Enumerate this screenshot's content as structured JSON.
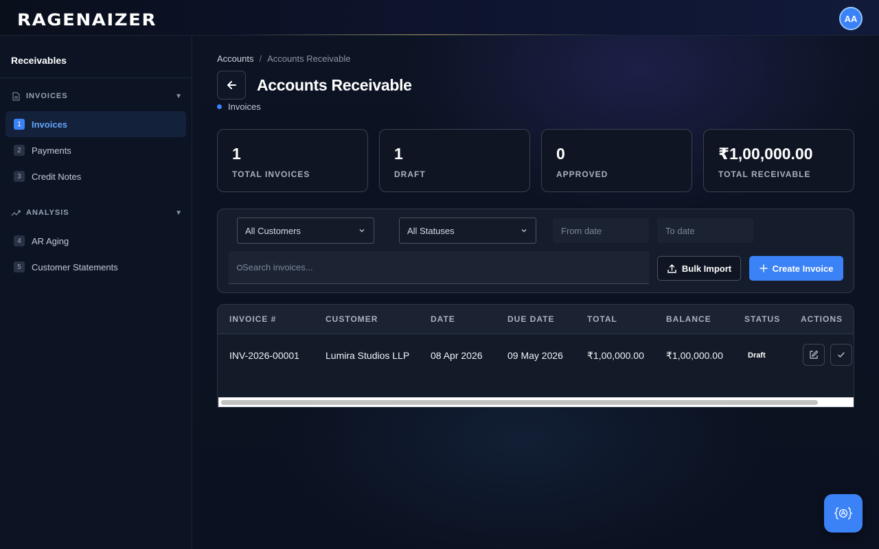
{
  "app": {
    "logo": "RAGENAIZER",
    "user_initials": "AA"
  },
  "sidebar": {
    "title": "Receivables",
    "sections": [
      {
        "label": "INVOICES",
        "icon": "document-icon"
      },
      {
        "label": "ANALYSIS",
        "icon": "trend-icon"
      }
    ],
    "items": [
      {
        "num": "1",
        "label": "Invoices",
        "active": true
      },
      {
        "num": "2",
        "label": "Payments"
      },
      {
        "num": "3",
        "label": "Credit Notes"
      },
      {
        "num": "4",
        "label": "AR Aging"
      },
      {
        "num": "5",
        "label": "Customer Statements"
      }
    ]
  },
  "breadcrumb": {
    "root": "Accounts",
    "separator": "/",
    "current": "Accounts Receivable"
  },
  "page": {
    "title": "Accounts Receivable",
    "subtitle": "Invoices"
  },
  "stats": [
    {
      "value": "1",
      "label": "TOTAL INVOICES"
    },
    {
      "value": "1",
      "label": "DRAFT"
    },
    {
      "value": "0",
      "label": "APPROVED"
    },
    {
      "value": "₹1,00,000.00",
      "label": "TOTAL RECEIVABLE"
    }
  ],
  "filters": {
    "customer": "All Customers",
    "status": "All Statuses",
    "from_date_placeholder": "From date",
    "to_date_placeholder": "To date",
    "search_placeholder": "Search invoices...",
    "bulk_import": "Bulk Import",
    "create_invoice": "Create Invoice"
  },
  "table": {
    "headers": [
      "INVOICE #",
      "CUSTOMER",
      "DATE",
      "DUE DATE",
      "TOTAL",
      "BALANCE",
      "STATUS",
      "ACTIONS"
    ],
    "rows": [
      {
        "invoice": "INV-2026-00001",
        "customer": "Lumira Studios LLP",
        "date": "08 Apr 2026",
        "due_date": "09 May 2026",
        "total": "₹1,00,000.00",
        "balance": "₹1,00,000.00",
        "status": "Draft"
      }
    ]
  },
  "colors": {
    "accent": "#3b82f6",
    "background": "#0b1220"
  }
}
